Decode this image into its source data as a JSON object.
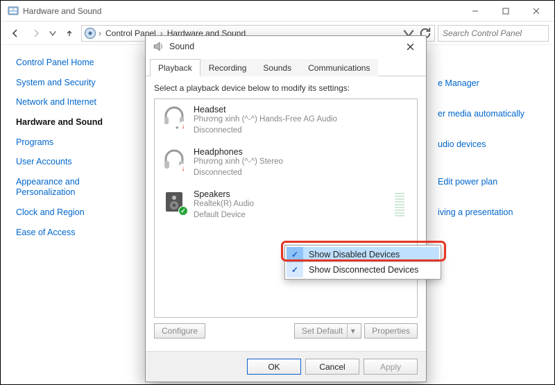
{
  "window": {
    "title": "Hardware and Sound",
    "breadcrumb": [
      "Control Panel",
      "Hardware and Sound"
    ],
    "search_placeholder": "Search Control Panel"
  },
  "leftnav": {
    "items": [
      {
        "label": "Control Panel Home",
        "current": false
      },
      {
        "label": "System and Security",
        "current": false
      },
      {
        "label": "Network and Internet",
        "current": false
      },
      {
        "label": "Hardware and Sound",
        "current": true
      },
      {
        "label": "Programs",
        "current": false
      },
      {
        "label": "User Accounts",
        "current": false
      },
      {
        "label": "Appearance and Personalization",
        "current": false
      },
      {
        "label": "Clock and Region",
        "current": false
      },
      {
        "label": "Ease of Access",
        "current": false
      }
    ]
  },
  "rightlinks": [
    "e Manager",
    "er media automatically",
    "udio devices",
    "Edit power plan",
    "iving a presentation"
  ],
  "sound_dialog": {
    "title": "Sound",
    "tabs": [
      "Playback",
      "Recording",
      "Sounds",
      "Communications"
    ],
    "active_tab": "Playback",
    "instruction": "Select a playback device below to modify its settings:",
    "devices": [
      {
        "name": "Headset",
        "line2": "Phương xinh (^-^) Hands-Free AG Audio",
        "line3": "Disconnected",
        "status": "disconnected",
        "icon": "headset"
      },
      {
        "name": "Headphones",
        "line2": "Phương xinh (^-^) Stereo",
        "line3": "Disconnected",
        "status": "disconnected",
        "icon": "headphones"
      },
      {
        "name": "Speakers",
        "line2": "Realtek(R) Audio",
        "line3": "Default Device",
        "status": "default",
        "icon": "speakers"
      }
    ],
    "buttons": {
      "configure": "Configure",
      "set_default": "Set Default",
      "properties": "Properties",
      "ok": "OK",
      "cancel": "Cancel",
      "apply": "Apply"
    }
  },
  "context_menu": {
    "items": [
      {
        "label": "Show Disabled Devices",
        "checked": true,
        "hover": true
      },
      {
        "label": "Show Disconnected Devices",
        "checked": true,
        "hover": false
      }
    ]
  }
}
